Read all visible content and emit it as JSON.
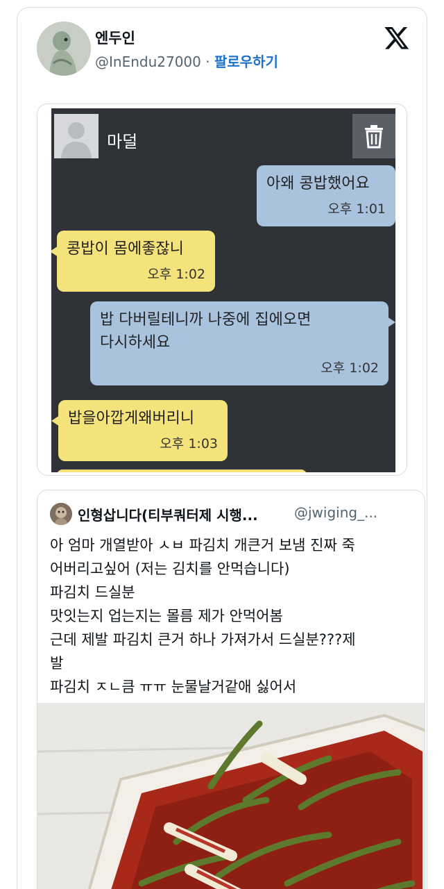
{
  "tweet": {
    "display_name": "엔두인",
    "handle": "@InEndu27000",
    "separator": " · ",
    "follow_label": "팔로우하기",
    "x_icon": "x-logo-icon"
  },
  "chat": {
    "contact_name": "마덜",
    "messages": [
      {
        "from": "me",
        "text": "아왜 콩밥했어요",
        "time": "오후 1:01"
      },
      {
        "from": "mom",
        "text": "콩밥이 몸에좋잖니",
        "time": "오후 1:02"
      },
      {
        "from": "me",
        "lines": [
          "밥 다버릴테니까 나중에 집에오면",
          "다시하세요"
        ],
        "time": "오후 1:02"
      },
      {
        "from": "mom",
        "text": "밥을아깝게왜버리니",
        "time": "오후 1:03"
      }
    ],
    "colors": {
      "background": "#2f3338",
      "me_bubble": "#a9c3df",
      "mom_bubble": "#f4e27a"
    }
  },
  "quote": {
    "display_name": "인형삽니다(티부쿼터제 시행...",
    "handle": "@jwiging_...",
    "lines": [
      "아 엄마 개열받아 ㅅㅂ 파김치 개큰거 보냄 진짜 죽",
      "어버리고싶어 (저는 김치를 안먹습니다)",
      "파김치 드실분",
      "맛잇는지 업는지는 몰름 제가 안먹어봄",
      "근데 제발 파김치 큰거 하나 가져가서 드실분???제",
      "발",
      "파김치 ㅈㄴ큼 ㅠㅠ 눈물날거같애 싫어서"
    ]
  },
  "colors": {
    "follow": "#1d72c8",
    "muted": "#536471",
    "border": "#d8dde1"
  }
}
